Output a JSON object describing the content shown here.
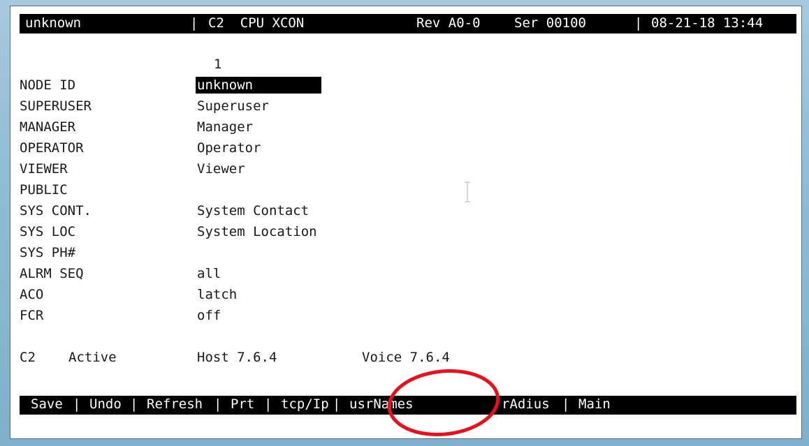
{
  "header": {
    "node": "unknown",
    "sep1": "|",
    "module": "C2  CPU XCON",
    "rev": "Rev A0-0",
    "serial": "Ser 00100",
    "sep2": "|",
    "datetime": "08-21-18 13:44"
  },
  "column_header": "1",
  "fields": [
    {
      "label": "NODE ID",
      "value": "unknown"
    },
    {
      "label": "SUPERUSER",
      "value": "Superuser"
    },
    {
      "label": "MANAGER",
      "value": "Manager"
    },
    {
      "label": "OPERATOR",
      "value": "Operator"
    },
    {
      "label": "VIEWER",
      "value": "Viewer"
    },
    {
      "label": "PUBLIC",
      "value": ""
    },
    {
      "label": "SYS CONT.",
      "value": "System Contact"
    },
    {
      "label": "SYS LOC",
      "value": "System Location"
    },
    {
      "label": "SYS PH#",
      "value": ""
    },
    {
      "label": "ALRM SEQ",
      "value": "all"
    },
    {
      "label": "ACO",
      "value": "latch"
    },
    {
      "label": "FCR",
      "value": "off"
    }
  ],
  "status": {
    "card": "C2",
    "state": "Active",
    "host": "Host 7.6.4",
    "voice": "Voice 7.6.4"
  },
  "menu": {
    "items": [
      {
        "label": "Save"
      },
      {
        "label": "Undo"
      },
      {
        "label": "Refresh"
      },
      {
        "label": "Prt"
      },
      {
        "label": "tcp/Ip"
      },
      {
        "label": "usrNames"
      },
      {
        "label": "rAdius"
      },
      {
        "label": "Main"
      }
    ],
    "separator": "|"
  },
  "colors": {
    "annotation": "#e8101c",
    "terminal_bg": "#ffffff",
    "bar_bg": "#000000"
  },
  "icons": {
    "cursor": "text-cursor-icon",
    "annotation": "highlight-circle-annotation"
  }
}
